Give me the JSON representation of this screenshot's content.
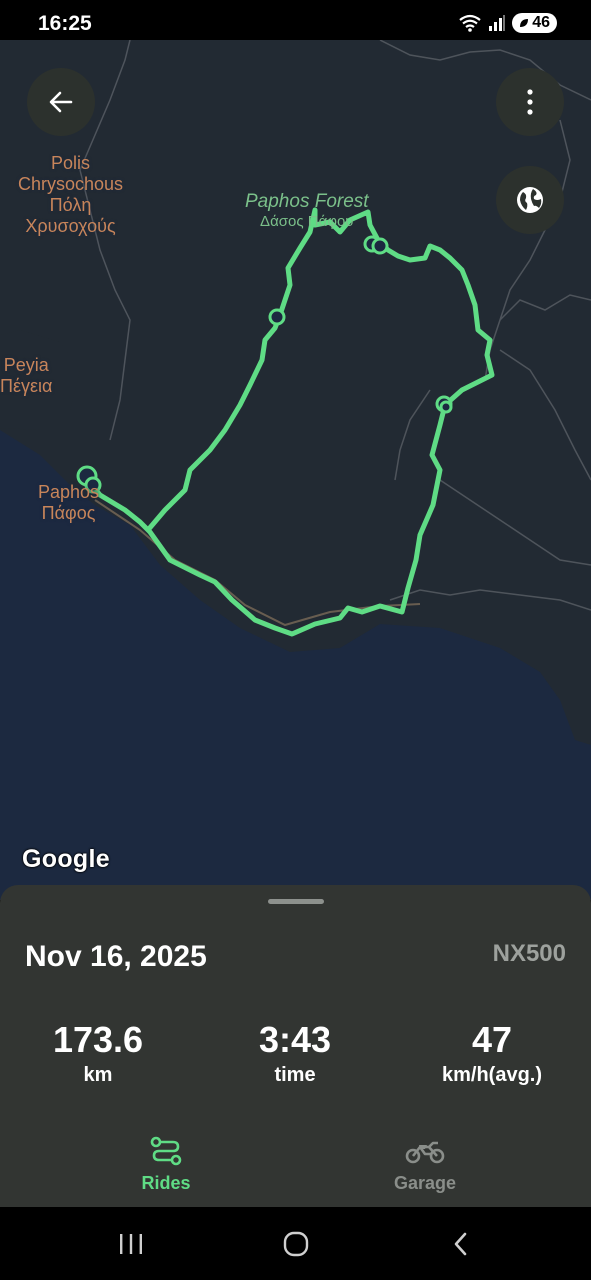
{
  "status_bar": {
    "time": "16:25",
    "battery": "46"
  },
  "map": {
    "labels": {
      "polis": [
        "Polis",
        "Chrysochous",
        "Πόλη",
        "Χρυσοχούς"
      ],
      "peyia": [
        "Peyia",
        "Πέγεια"
      ],
      "paphos": [
        "Paphos",
        "Πάφος"
      ],
      "forest_main": "Paphos Forest",
      "forest_sub": "Δάσος Πάφου"
    },
    "attribution": "Google",
    "route_color": "#5fdc85",
    "water_color": "#1c2940",
    "land_color": "#222a33"
  },
  "ride": {
    "date": "Nov 16, 2025",
    "bike": "NX500",
    "stats": {
      "distance_value": "173.6",
      "distance_unit": "km",
      "time_value": "3:43",
      "time_unit": "time",
      "speed_value": "47",
      "speed_unit": "km/h(avg.)"
    }
  },
  "tabs": {
    "rides": "Rides",
    "garage": "Garage",
    "active_color": "#5fdc85",
    "inactive_color": "#8a8e8a"
  },
  "icons": [
    "back-arrow-icon",
    "more-vert-icon",
    "globe-icon",
    "route-icon",
    "motorcycle-icon",
    "recent-apps-icon",
    "home-icon",
    "back-icon"
  ]
}
